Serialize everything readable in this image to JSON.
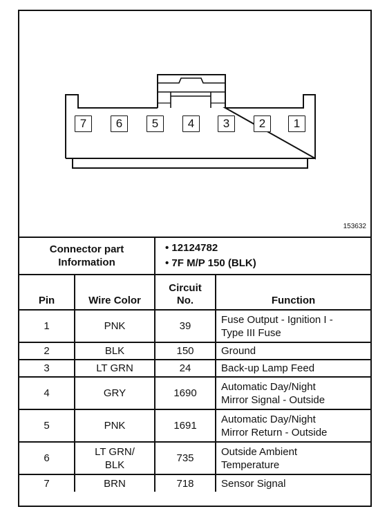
{
  "diagram": {
    "figure_id": "153632",
    "connector_pins": [
      "7",
      "6",
      "5",
      "4",
      "3",
      "2",
      "1"
    ]
  },
  "connector_info": {
    "label_line1": "Connector part",
    "label_line2": "Information",
    "items": [
      "• 12124782",
      "• 7F M/P 150 (BLK)"
    ]
  },
  "table": {
    "headers": {
      "pin": "Pin",
      "wire_color": "Wire Color",
      "circuit_line1": "Circuit",
      "circuit_line2": "No.",
      "function": "Function"
    },
    "rows": [
      {
        "pin": "1",
        "wire_color": [
          "PNK"
        ],
        "circuit": "39",
        "function": [
          "Fuse Output - Ignition I -",
          "Type III Fuse"
        ]
      },
      {
        "pin": "2",
        "wire_color": [
          "BLK"
        ],
        "circuit": "150",
        "function": [
          "Ground"
        ]
      },
      {
        "pin": "3",
        "wire_color": [
          "LT GRN"
        ],
        "circuit": "24",
        "function": [
          "Back-up Lamp Feed"
        ]
      },
      {
        "pin": "4",
        "wire_color": [
          "GRY"
        ],
        "circuit": "1690",
        "function": [
          "Automatic Day/Night",
          "Mirror Signal - Outside"
        ]
      },
      {
        "pin": "5",
        "wire_color": [
          "PNK"
        ],
        "circuit": "1691",
        "function": [
          "Automatic Day/Night",
          "Mirror Return - Outside"
        ]
      },
      {
        "pin": "6",
        "wire_color": [
          "LT GRN/",
          "BLK"
        ],
        "circuit": "735",
        "function": [
          "Outside Ambient",
          "Temperature"
        ]
      },
      {
        "pin": "7",
        "wire_color": [
          "BRN"
        ],
        "circuit": "718",
        "function": [
          "Sensor Signal"
        ]
      }
    ]
  }
}
